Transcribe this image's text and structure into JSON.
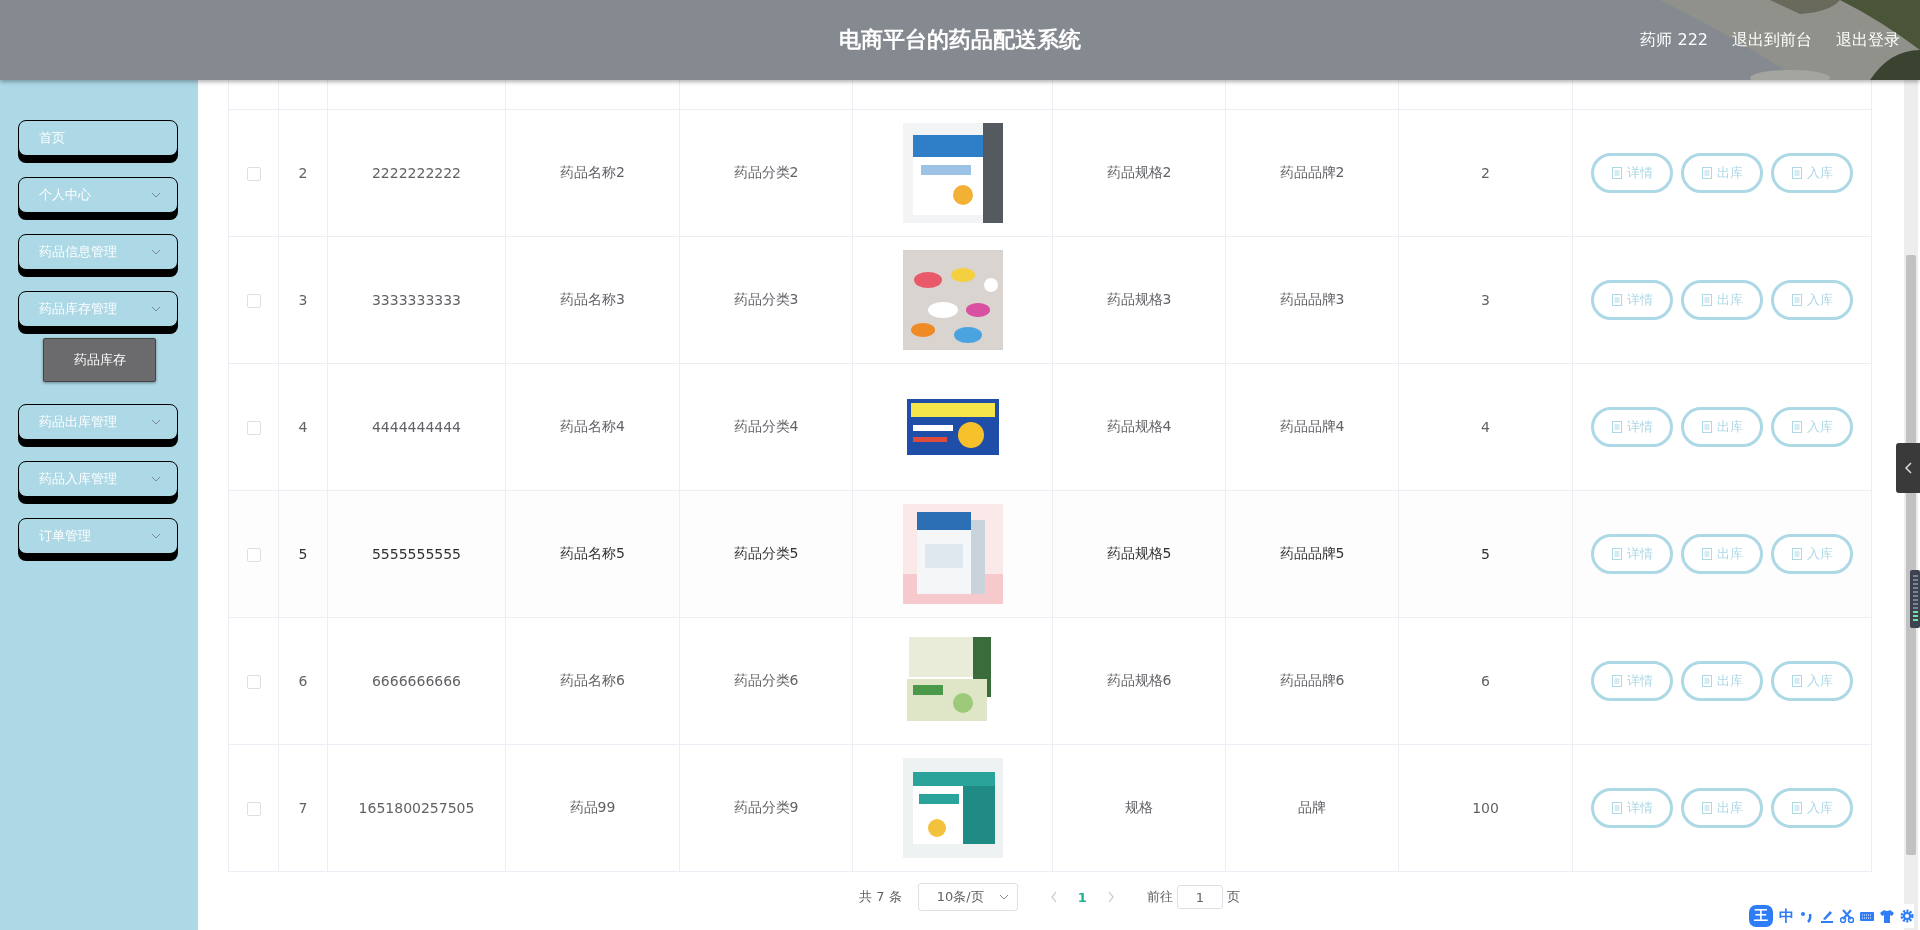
{
  "header": {
    "title": "电商平台的药品配送系统",
    "links": [
      "药师 222",
      "退出到前台",
      "退出登录"
    ]
  },
  "sidebar": {
    "items": [
      {
        "label": "首页",
        "expandable": false
      },
      {
        "label": "个人中心",
        "expandable": true
      },
      {
        "label": "药品信息管理",
        "expandable": true
      },
      {
        "label": "药品库存管理",
        "expandable": true,
        "children": [
          {
            "label": "药品库存",
            "selected": true
          }
        ]
      },
      {
        "label": "药品出库管理",
        "expandable": true
      },
      {
        "label": "药品入库管理",
        "expandable": true
      },
      {
        "label": "订单管理",
        "expandable": true
      }
    ]
  },
  "table": {
    "rows": [
      {
        "checked": false,
        "hovered": false,
        "index": "2",
        "code": "2222222222",
        "name": "药品名称2",
        "category": "药品分类2",
        "spec": "药品规格2",
        "brand": "药品品牌2",
        "quantity": "2",
        "actions": [
          "详情",
          "出库",
          "入库"
        ]
      },
      {
        "checked": false,
        "hovered": false,
        "index": "3",
        "code": "3333333333",
        "name": "药品名称3",
        "category": "药品分类3",
        "spec": "药品规格3",
        "brand": "药品品牌3",
        "quantity": "3",
        "actions": [
          "详情",
          "出库",
          "入库"
        ]
      },
      {
        "checked": false,
        "hovered": false,
        "index": "4",
        "code": "4444444444",
        "name": "药品名称4",
        "category": "药品分类4",
        "spec": "药品规格4",
        "brand": "药品品牌4",
        "quantity": "4",
        "actions": [
          "详情",
          "出库",
          "入库"
        ]
      },
      {
        "checked": false,
        "hovered": true,
        "index": "5",
        "code": "5555555555",
        "name": "药品名称5",
        "category": "药品分类5",
        "spec": "药品规格5",
        "brand": "药品品牌5",
        "quantity": "5",
        "actions": [
          "详情",
          "出库",
          "入库"
        ]
      },
      {
        "checked": false,
        "hovered": false,
        "index": "6",
        "code": "6666666666",
        "name": "药品名称6",
        "category": "药品分类6",
        "spec": "药品规格6",
        "brand": "药品品牌6",
        "quantity": "6",
        "actions": [
          "详情",
          "出库",
          "入库"
        ]
      },
      {
        "checked": false,
        "hovered": false,
        "index": "7",
        "code": "1651800257505",
        "name": "药品99",
        "category": "药品分类9",
        "spec": "规格",
        "brand": "品牌",
        "quantity": "100",
        "actions": [
          "详情",
          "出库",
          "入库"
        ]
      }
    ]
  },
  "pagination": {
    "total": "共 7 条",
    "page_size": "10条/页",
    "pages": [
      {
        "label": "1",
        "selected": true
      }
    ],
    "goto_label": "前往",
    "goto_value": "1",
    "goto_suffix": "页"
  },
  "ime_toolbar": {
    "logo": "王",
    "mode": "中"
  }
}
